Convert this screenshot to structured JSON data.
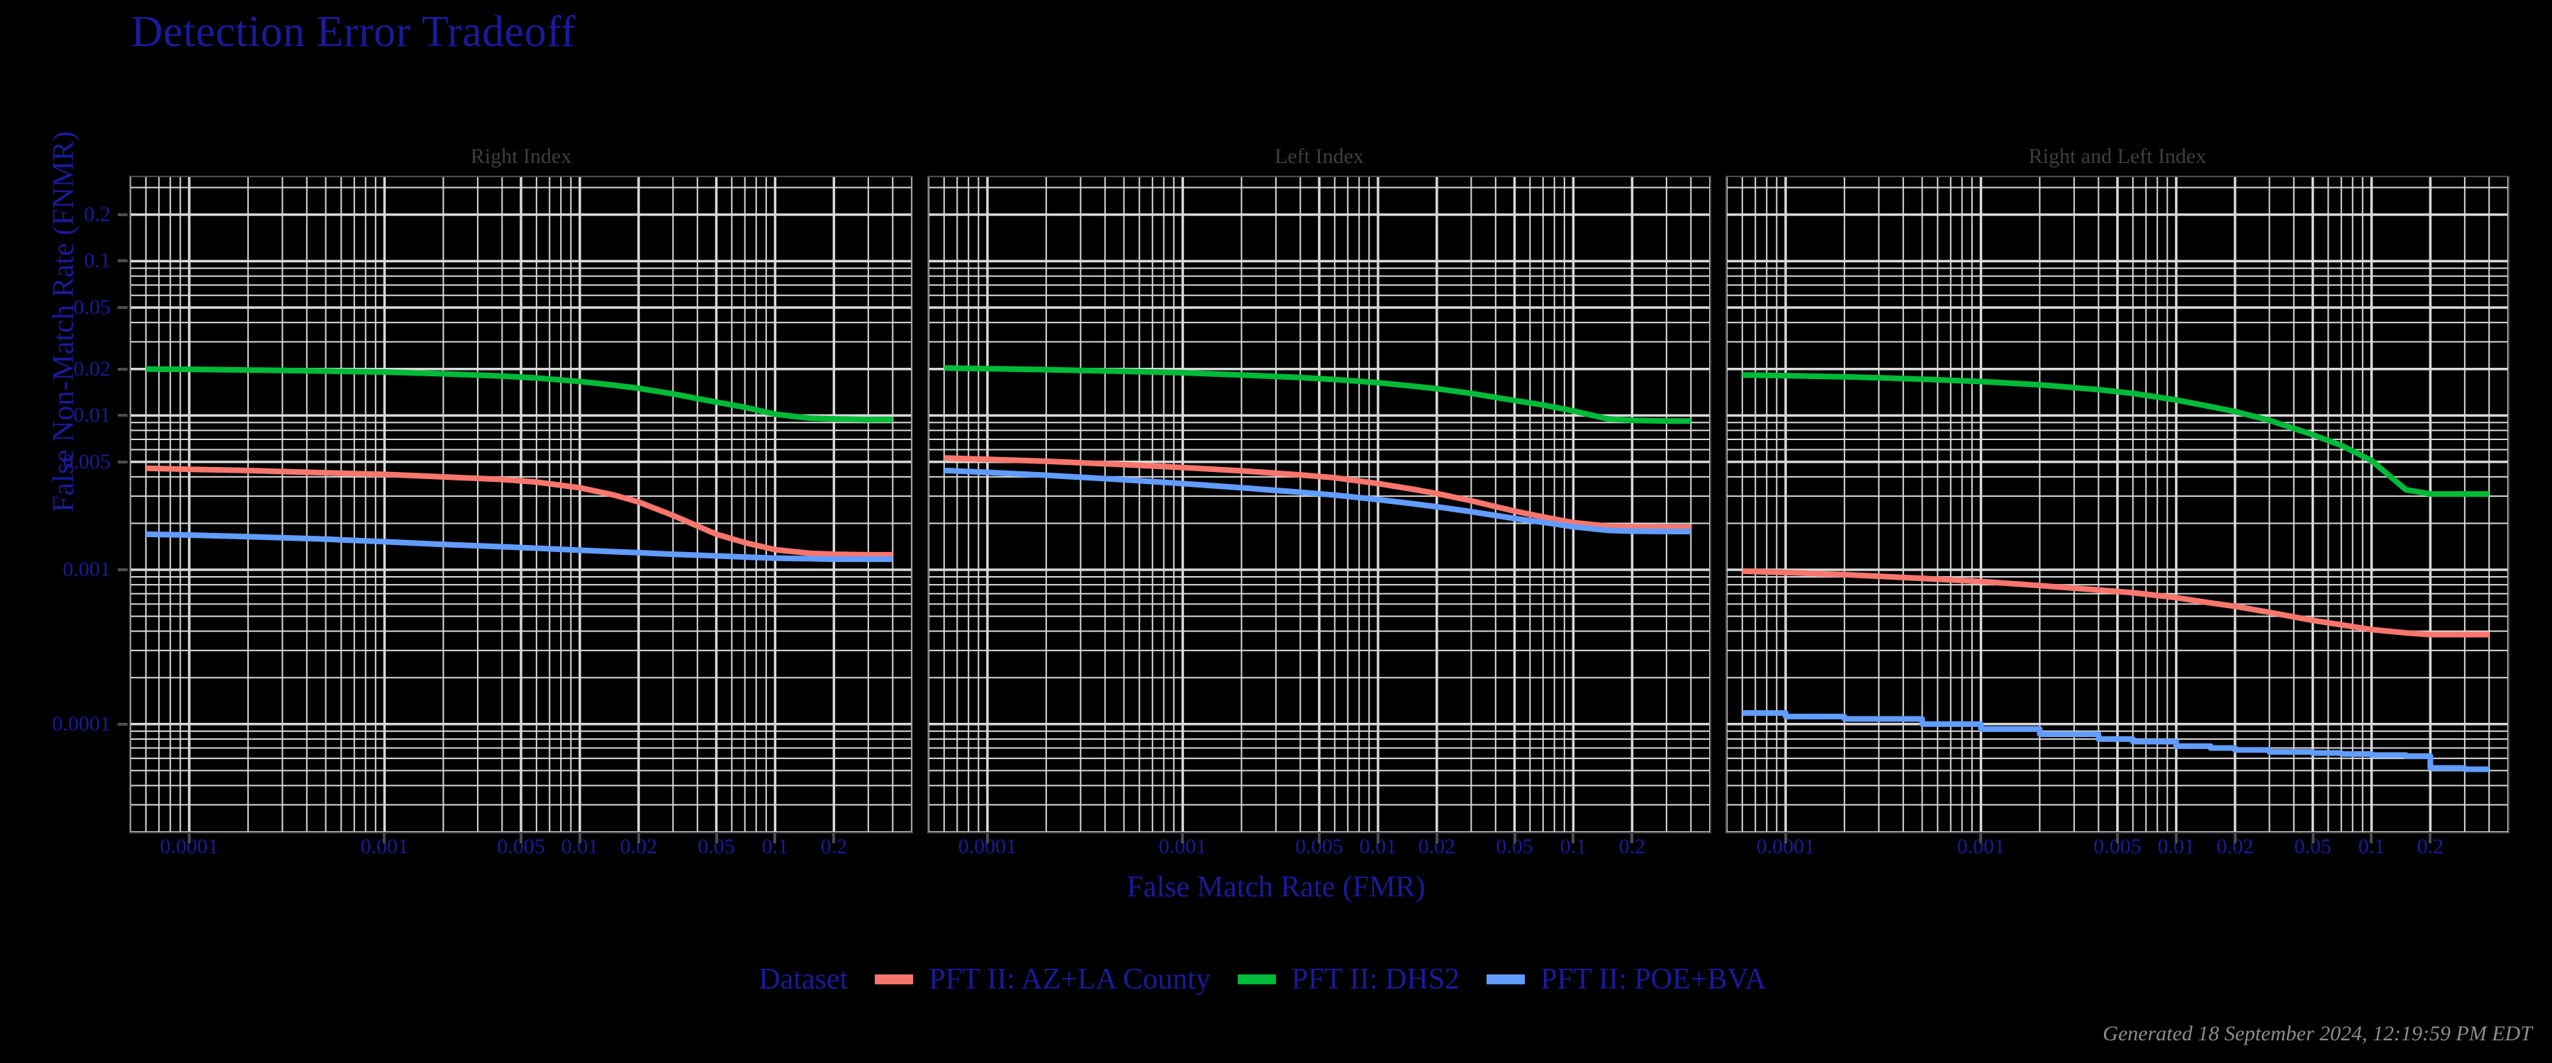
{
  "title": "Detection Error Tradeoff",
  "axes": {
    "x_label": "False Match Rate (FMR)",
    "y_label": "False Non-Match Rate (FNMR)"
  },
  "footer": "Generated 18 September 2024, 12:19:59 PM EDT",
  "legend": {
    "title": "Dataset",
    "items": [
      {
        "label": "PFT II: AZ+LA County",
        "color": "#F8766D"
      },
      {
        "label": "PFT II: DHS2",
        "color": "#00BA38"
      },
      {
        "label": "PFT II: POE+BVA",
        "color": "#619CFF"
      }
    ]
  },
  "panels": [
    {
      "title": "Right Index"
    },
    {
      "title": "Left Index"
    },
    {
      "title": "Right and Left Index"
    }
  ],
  "chart_data": {
    "type": "line",
    "title": "Detection Error Tradeoff",
    "xlabel": "False Match Rate (FMR)",
    "ylabel": "False Non-Match Rate (FNMR)",
    "xscale": "log",
    "yscale": "log",
    "xlim": [
      5e-05,
      0.5
    ],
    "ylim": [
      2e-05,
      0.35
    ],
    "grid": true,
    "legend_position": "bottom",
    "legend_title": "Dataset",
    "xticks": [
      0.0001,
      0.001,
      0.005,
      0.01,
      0.02,
      0.05,
      0.1,
      0.2
    ],
    "xticklabels": [
      "0.0001",
      "0.001",
      "0.005",
      "0.01",
      "0.02",
      "0.05",
      "0.1",
      "0.2"
    ],
    "yticks": [
      0.2,
      0.1,
      0.05,
      0.02,
      0.01,
      0.005,
      0.001,
      0.0001
    ],
    "yticklabels": [
      "0.2",
      "0.1",
      "0.05",
      "0.02",
      "0.01",
      "0.005",
      "0.001",
      "0.0001"
    ],
    "facets": [
      {
        "title": "Right Index",
        "series": [
          {
            "name": "PFT II: AZ+LA County",
            "color": "#F8766D",
            "x": [
              6e-05,
              0.0001,
              0.0002,
              0.0005,
              0.001,
              0.002,
              0.004,
              0.006,
              0.01,
              0.015,
              0.02,
              0.03,
              0.05,
              0.07,
              0.1,
              0.15,
              0.2,
              0.3,
              0.4
            ],
            "y": [
              0.00455,
              0.00448,
              0.0044,
              0.00425,
              0.00415,
              0.004,
              0.00385,
              0.0037,
              0.0034,
              0.00305,
              0.00275,
              0.00225,
              0.0017,
              0.0015,
              0.00135,
              0.00128,
              0.00126,
              0.00125,
              0.00125
            ]
          },
          {
            "name": "PFT II: DHS2",
            "color": "#00BA38",
            "x": [
              6e-05,
              0.0001,
              0.0002,
              0.0005,
              0.001,
              0.002,
              0.004,
              0.006,
              0.01,
              0.015,
              0.02,
              0.03,
              0.05,
              0.07,
              0.1,
              0.15,
              0.2,
              0.3,
              0.4
            ],
            "y": [
              0.02,
              0.0199,
              0.0197,
              0.0194,
              0.0191,
              0.0186,
              0.018,
              0.0175,
              0.0166,
              0.0157,
              0.015,
              0.0138,
              0.0122,
              0.0113,
              0.0102,
              0.0096,
              0.0095,
              0.0094,
              0.0094
            ]
          },
          {
            "name": "PFT II: POE+BVA",
            "color": "#619CFF",
            "x": [
              6e-05,
              0.0001,
              0.0002,
              0.0005,
              0.001,
              0.002,
              0.004,
              0.006,
              0.01,
              0.015,
              0.02,
              0.03,
              0.05,
              0.07,
              0.1,
              0.15,
              0.2,
              0.3,
              0.4
            ],
            "y": [
              0.0017,
              0.00168,
              0.00164,
              0.00158,
              0.00152,
              0.00146,
              0.00141,
              0.00138,
              0.00134,
              0.00131,
              0.00129,
              0.00126,
              0.00123,
              0.00121,
              0.00119,
              0.00118,
              0.00117,
              0.00117,
              0.00117
            ]
          }
        ]
      },
      {
        "title": "Left Index",
        "series": [
          {
            "name": "PFT II: AZ+LA County",
            "color": "#F8766D",
            "x": [
              6e-05,
              0.0001,
              0.0002,
              0.0005,
              0.001,
              0.002,
              0.004,
              0.006,
              0.01,
              0.015,
              0.02,
              0.03,
              0.05,
              0.07,
              0.1,
              0.15,
              0.2,
              0.3,
              0.4
            ],
            "y": [
              0.0053,
              0.0052,
              0.00505,
              0.0048,
              0.0046,
              0.00438,
              0.00412,
              0.00395,
              0.00362,
              0.00333,
              0.00312,
              0.0028,
              0.0024,
              0.0022,
              0.00202,
              0.00192,
              0.0019,
              0.00189,
              0.00189
            ]
          },
          {
            "name": "PFT II: DHS2",
            "color": "#00BA38",
            "x": [
              6e-05,
              0.0001,
              0.0002,
              0.0005,
              0.001,
              0.002,
              0.004,
              0.006,
              0.01,
              0.015,
              0.02,
              0.03,
              0.05,
              0.07,
              0.1,
              0.15,
              0.2,
              0.3,
              0.4
            ],
            "y": [
              0.0203,
              0.0201,
              0.0198,
              0.0193,
              0.0189,
              0.0183,
              0.0176,
              0.0171,
              0.0163,
              0.0155,
              0.0149,
              0.0139,
              0.0125,
              0.0117,
              0.0107,
              0.0095,
              0.0093,
              0.0092,
              0.0092
            ]
          },
          {
            "name": "PFT II: POE+BVA",
            "color": "#619CFF",
            "x": [
              6e-05,
              0.0001,
              0.0002,
              0.0005,
              0.001,
              0.002,
              0.004,
              0.006,
              0.01,
              0.015,
              0.02,
              0.03,
              0.05,
              0.07,
              0.1,
              0.15,
              0.2,
              0.3,
              0.4
            ],
            "y": [
              0.0044,
              0.00428,
              0.0041,
              0.00383,
              0.00362,
              0.0034,
              0.00318,
              0.00305,
              0.00285,
              0.00268,
              0.00256,
              0.00238,
              0.00215,
              0.00203,
              0.0019,
              0.0018,
              0.00178,
              0.00177,
              0.00177
            ]
          }
        ]
      },
      {
        "title": "Right and Left Index",
        "series": [
          {
            "name": "PFT II: AZ+LA County",
            "color": "#F8766D",
            "x": [
              6e-05,
              0.0001,
              0.0002,
              0.0005,
              0.001,
              0.002,
              0.004,
              0.006,
              0.01,
              0.015,
              0.02,
              0.03,
              0.05,
              0.07,
              0.1,
              0.15,
              0.2,
              0.3,
              0.4
            ],
            "y": [
              0.00098,
              0.00096,
              0.00093,
              0.00088,
              0.00084,
              0.00079,
              0.00074,
              0.00071,
              0.00066,
              0.00061,
              0.00058,
              0.00053,
              0.00047,
              0.00044,
              0.00041,
              0.00039,
              0.00038,
              0.00038,
              0.00038
            ]
          },
          {
            "name": "PFT II: DHS2",
            "color": "#00BA38",
            "x": [
              6e-05,
              0.0001,
              0.0002,
              0.0005,
              0.001,
              0.002,
              0.004,
              0.006,
              0.01,
              0.015,
              0.02,
              0.03,
              0.05,
              0.07,
              0.1,
              0.15,
              0.2,
              0.3,
              0.4
            ],
            "y": [
              0.0183,
              0.0181,
              0.0178,
              0.0172,
              0.0166,
              0.0158,
              0.0147,
              0.0139,
              0.0126,
              0.0114,
              0.0106,
              0.0093,
              0.0075,
              0.0064,
              0.0051,
              0.0033,
              0.0031,
              0.0031,
              0.0031
            ]
          },
          {
            "name": "PFT II: POE+BVA",
            "color": "#619CFF",
            "x": [
              6e-05,
              0.0001,
              0.0002,
              0.0005,
              0.001,
              0.002,
              0.004,
              0.006,
              0.01,
              0.015,
              0.02,
              0.03,
              0.05,
              0.07,
              0.1,
              0.15,
              0.2,
              0.3,
              0.4
            ],
            "y": [
              0.000118,
              0.000112,
              0.000108,
              0.0001,
              9.3e-05,
              8.6e-05,
              8e-05,
              7.7e-05,
              7.2e-05,
              7e-05,
              6.8e-05,
              6.6e-05,
              6.5e-05,
              6.4e-05,
              6.3e-05,
              6.2e-05,
              5.2e-05,
              5.1e-05,
              5.1e-05
            ]
          }
        ]
      }
    ]
  }
}
